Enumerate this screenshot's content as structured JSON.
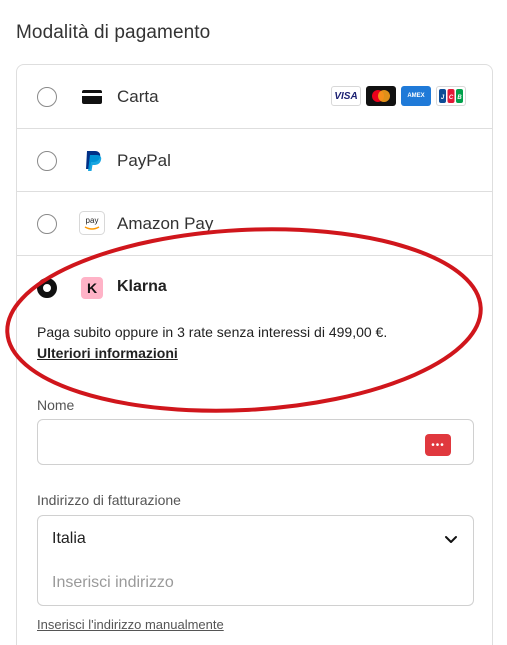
{
  "section": {
    "title": "Modalità di pagamento"
  },
  "methods": {
    "card": {
      "label": "Carta",
      "icon": "credit-card-icon",
      "brands": [
        "VISA",
        "Mastercard",
        "AMEX",
        "JCB"
      ]
    },
    "paypal": {
      "label": "PayPal",
      "icon": "paypal-icon"
    },
    "amazon": {
      "label": "Amazon Pay",
      "icon": "amazon-pay-icon",
      "icon_text": "pay"
    },
    "klarna": {
      "label": "Klarna",
      "icon": "klarna-icon",
      "icon_text": "K",
      "selected": true,
      "description": "Paga subito oppure in 3 rate senza interessi di 499,00 €.",
      "more_info": "Ulteriori informazioni"
    }
  },
  "form": {
    "name_label": "Nome",
    "name_value": "",
    "address_label": "Indirizzo di fatturazione",
    "country_value": "Italia",
    "address_placeholder": "Inserisci indirizzo",
    "manual_link": "Inserisci l'indirizzo manualmente"
  },
  "colors": {
    "annotation": "#d0161c",
    "klarna_pink": "#ffb3c7",
    "paypal_dark": "#003087",
    "paypal_light": "#009cde",
    "autofill": "#e0383e"
  }
}
